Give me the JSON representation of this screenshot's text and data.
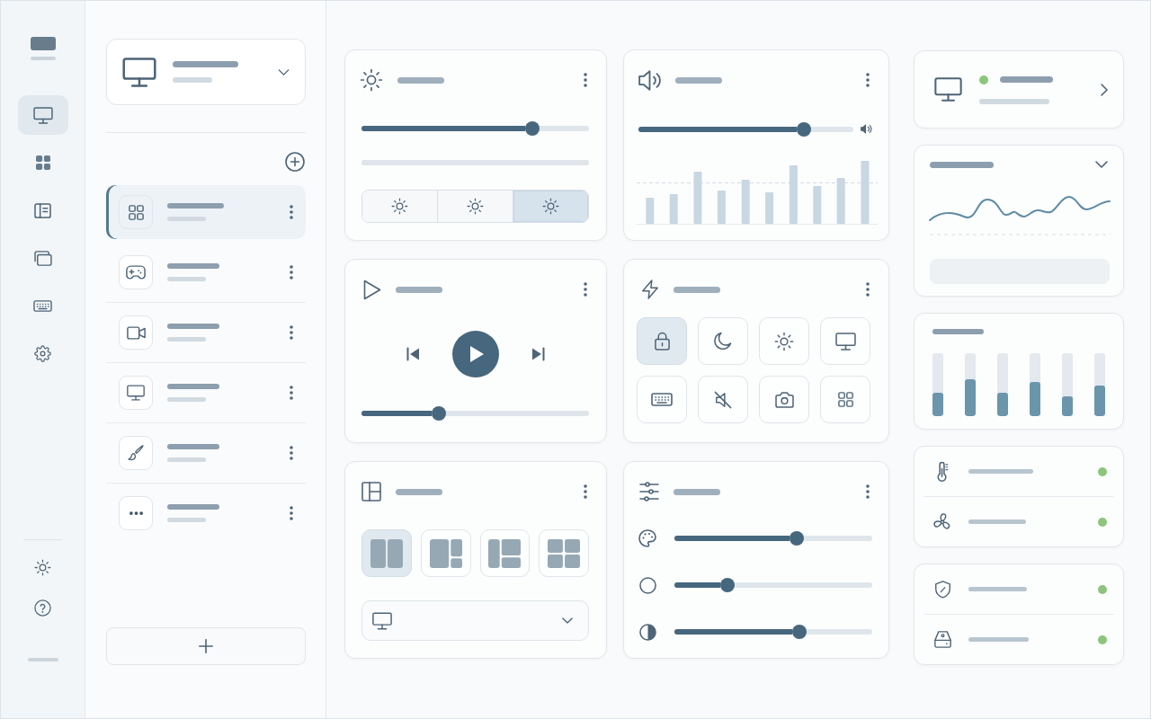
{
  "nav_rail": {
    "items": [
      {
        "selected": true
      },
      {
        "selected": false
      },
      {
        "selected": false
      },
      {
        "selected": false
      },
      {
        "selected": false
      },
      {
        "selected": false
      }
    ]
  },
  "sidebar": {
    "profiles": [
      {
        "selected": true
      },
      {
        "selected": false
      },
      {
        "selected": false
      },
      {
        "selected": false
      },
      {
        "selected": false
      },
      {
        "selected": false
      }
    ]
  },
  "brightness": {
    "level": 0.75,
    "segments": [
      {
        "selected": false
      },
      {
        "selected": false
      },
      {
        "selected": true
      }
    ]
  },
  "volume": {
    "level": 0.77
  },
  "media": {
    "playing": false,
    "level": 0.34
  },
  "quick_toggles": [
    {
      "on": true
    },
    {
      "on": false
    },
    {
      "on": false
    },
    {
      "on": false
    },
    {
      "on": false
    },
    {
      "on": false
    },
    {
      "on": false
    },
    {
      "on": false
    }
  ],
  "layouts": [
    {
      "selected": true
    },
    {
      "selected": false
    },
    {
      "selected": false
    },
    {
      "selected": false
    }
  ],
  "adjustments": [
    {
      "level": 0.62
    },
    {
      "level": 0.27
    },
    {
      "level": 0.63
    }
  ],
  "device": {
    "color": "#8cc57b"
  },
  "meters": [
    {
      "level": 0.37
    },
    {
      "level": 0.58
    },
    {
      "level": 0.37
    },
    {
      "level": 0.55
    },
    {
      "level": 0.31
    },
    {
      "level": 0.49
    }
  ],
  "sensors": [
    {
      "color": "#8cc57b"
    },
    {
      "color": "#8cc57b"
    }
  ],
  "health": [
    {
      "color": "#8cc57b"
    },
    {
      "color": "#8cc57b"
    }
  ]
}
